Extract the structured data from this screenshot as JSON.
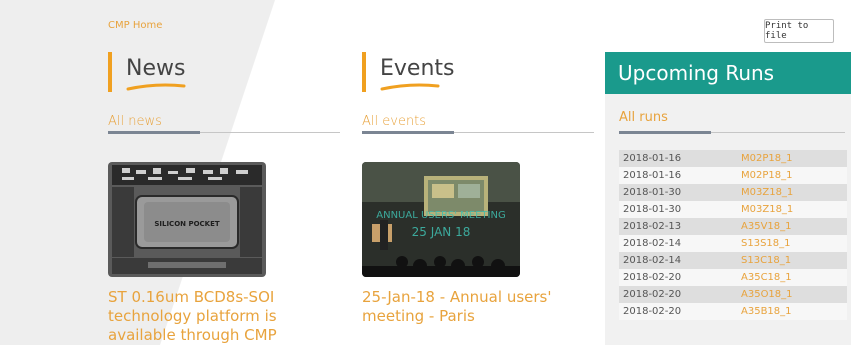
{
  "breadcrumb": "CMP Home",
  "print_button": "Print to file",
  "news": {
    "title": "News",
    "all_link": "All news",
    "thumb_label": "SILICON POCKET",
    "caption": "ST 0.16um BCD8s-SOI technology platform is available through CMP"
  },
  "events": {
    "title": "Events",
    "all_link": "All events",
    "thumb_overlay_line1": "ANNUAL USERS' MEETING",
    "thumb_overlay_line2": "25 JAN 18",
    "caption": "25-Jan-18 - Annual users' meeting - Paris"
  },
  "runs": {
    "title": "Upcoming Runs",
    "all_link": "All runs",
    "rows": [
      {
        "date": "2018-01-16",
        "run": "M02P18_1"
      },
      {
        "date": "2018-01-16",
        "run": "M02P18_1"
      },
      {
        "date": "2018-01-30",
        "run": "M03Z18_1"
      },
      {
        "date": "2018-01-30",
        "run": "M03Z18_1"
      },
      {
        "date": "2018-02-13",
        "run": "A35V18_1"
      },
      {
        "date": "2018-02-14",
        "run": "S13S18_1"
      },
      {
        "date": "2018-02-14",
        "run": "S13C18_1"
      },
      {
        "date": "2018-02-20",
        "run": "A35C18_1"
      },
      {
        "date": "2018-02-20",
        "run": "A35O18_1"
      },
      {
        "date": "2018-02-20",
        "run": "A35B18_1"
      }
    ]
  },
  "colors": {
    "accent": "#e8a33d",
    "teal": "#1a9a8c",
    "heading_bar": "#f0a020"
  }
}
